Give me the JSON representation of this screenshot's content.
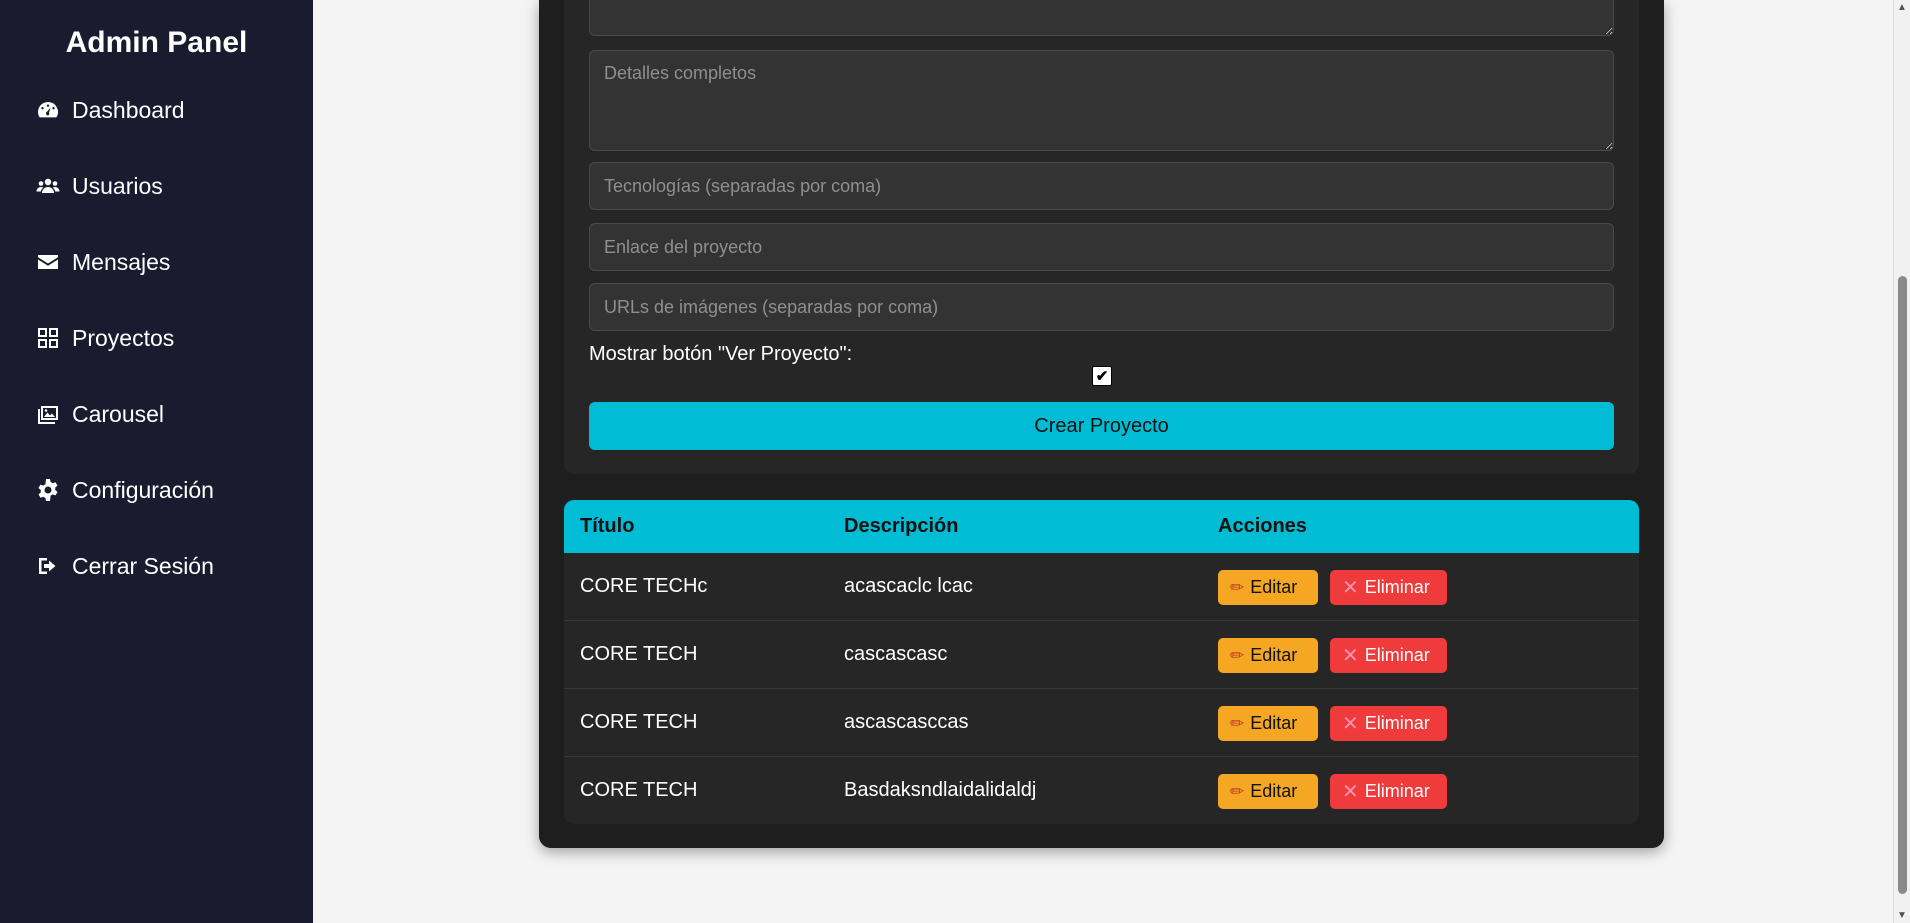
{
  "sidebar": {
    "title": "Admin Panel",
    "items": [
      {
        "label": "Dashboard",
        "icon": "dashboard-icon"
      },
      {
        "label": "Usuarios",
        "icon": "users-icon"
      },
      {
        "label": "Mensajes",
        "icon": "envelope-icon"
      },
      {
        "label": "Proyectos",
        "icon": "grid-icon"
      },
      {
        "label": "Carousel",
        "icon": "images-icon"
      },
      {
        "label": "Configuración",
        "icon": "gear-icon"
      },
      {
        "label": "Cerrar Sesión",
        "icon": "logout-icon"
      }
    ]
  },
  "form": {
    "short_description_placeholder": "",
    "details_placeholder": "Detalles completos",
    "technologies_placeholder": "Tecnologías (separadas por coma)",
    "link_placeholder": "Enlace del proyecto",
    "images_placeholder": "URLs de imágenes (separadas por coma)",
    "show_button_label": "Mostrar botón \"Ver Proyecto\":",
    "show_button_checked": true,
    "submit_label": "Crear Proyecto"
  },
  "table": {
    "headers": [
      "Título",
      "Descripción",
      "Acciones"
    ],
    "edit_label": "Editar",
    "delete_label": "Eliminar",
    "rows": [
      {
        "title": "CORE TECHc",
        "description": "acascaclc lcac"
      },
      {
        "title": "CORE TECH",
        "description": "cascascasc"
      },
      {
        "title": "CORE TECH",
        "description": "ascascasccas"
      },
      {
        "title": "CORE TECH",
        "description": "Basdaksndlaidalidaldj"
      }
    ]
  },
  "colors": {
    "sidebar_bg": "#1a1b2e",
    "accent": "#00bcd4",
    "edit": "#f5a623",
    "delete": "#ef3b3b"
  }
}
